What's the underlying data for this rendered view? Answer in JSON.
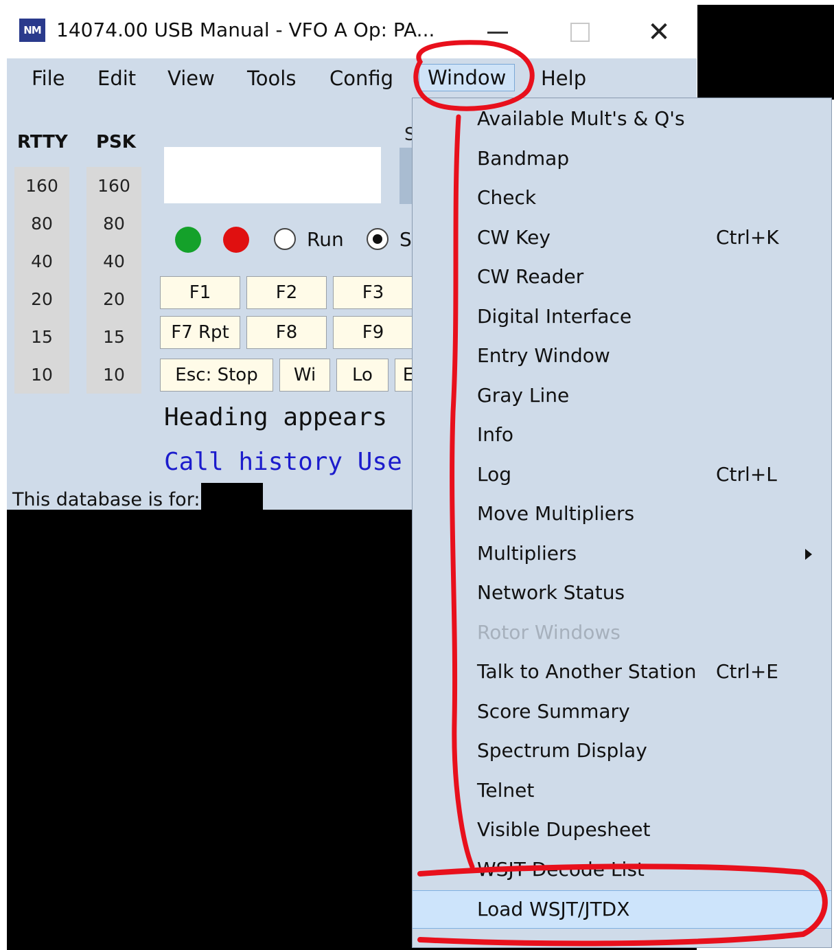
{
  "window": {
    "title": "14074.00 USB Manual - VFO A    Op: PA...",
    "logo_text": "NM"
  },
  "menu": {
    "items": [
      "File",
      "Edit",
      "View",
      "Tools",
      "Config",
      "Window",
      "Help"
    ],
    "active": "Window"
  },
  "bands": {
    "rtty_header": "RTTY",
    "psk_header": "PSK",
    "values": [
      "160",
      "80",
      "40",
      "20",
      "15",
      "10"
    ]
  },
  "entry": {
    "s_label": "S",
    "run_label": "Run",
    "sp_label": "S",
    "fkeys_row1": [
      "F1",
      "F2",
      "F3"
    ],
    "fkeys_row2": [
      "F7 Rpt",
      "F8",
      "F9"
    ],
    "fkeys_row3": [
      "Esc: Stop",
      "Wi",
      "Lo",
      "E"
    ],
    "heading_text": "Heading appears",
    "callhistory_text": "Call history Use",
    "database_text": "This database is for:"
  },
  "window_menu": {
    "items": [
      {
        "label": "Available Mult's & Q's",
        "shortcut": ""
      },
      {
        "label": "Bandmap",
        "shortcut": ""
      },
      {
        "label": "Check",
        "shortcut": ""
      },
      {
        "label": "CW Key",
        "shortcut": "Ctrl+K"
      },
      {
        "label": "CW Reader",
        "shortcut": ""
      },
      {
        "label": "Digital Interface",
        "shortcut": ""
      },
      {
        "label": "Entry Window",
        "shortcut": ""
      },
      {
        "label": "Gray Line",
        "shortcut": ""
      },
      {
        "label": "Info",
        "shortcut": ""
      },
      {
        "label": "Log",
        "shortcut": "Ctrl+L"
      },
      {
        "label": "Move Multipliers",
        "shortcut": ""
      },
      {
        "label": "Multipliers",
        "shortcut": ""
      },
      {
        "label": "Network Status",
        "shortcut": ""
      },
      {
        "label": "Rotor Windows",
        "shortcut": ""
      },
      {
        "label": "Talk to Another Station",
        "shortcut": "Ctrl+E"
      },
      {
        "label": "Score Summary",
        "shortcut": ""
      },
      {
        "label": "Spectrum Display",
        "shortcut": ""
      },
      {
        "label": "Telnet",
        "shortcut": ""
      },
      {
        "label": "Visible Dupesheet",
        "shortcut": ""
      },
      {
        "label": "WSJT Decode List",
        "shortcut": ""
      },
      {
        "label": "Load WSJT/JTDX",
        "shortcut": ""
      }
    ],
    "disabled_item": "Rotor Windows",
    "highlighted_item": "Load WSJT/JTDX",
    "submenu_item": "Multipliers"
  },
  "colors": {
    "annotation": "#e8101c",
    "menu_bg": "#cfdbe9",
    "highlight_bg": "#cde4fb",
    "callhistory_text": "#1c1ccc"
  }
}
